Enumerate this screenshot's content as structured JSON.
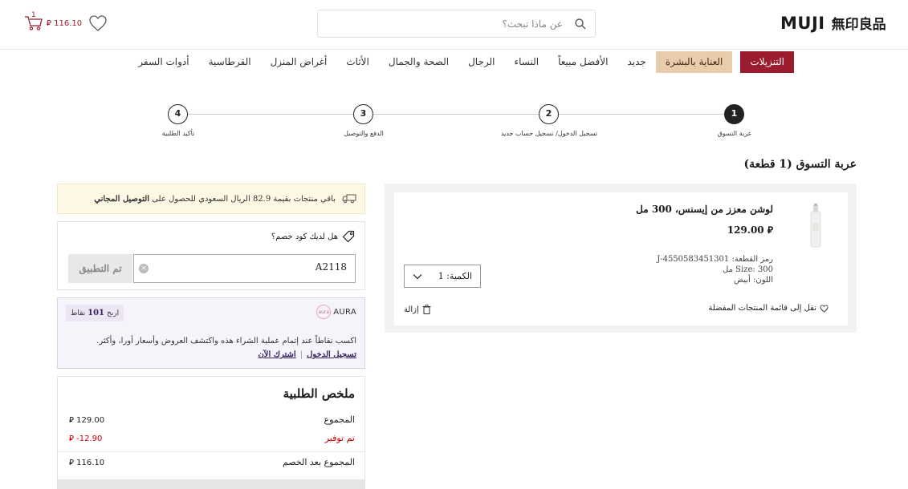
{
  "header": {
    "logo_latin": "MUJI",
    "logo_kanji": "無印良品",
    "search_placeholder": "عن ماذا تبحث؟",
    "cart_count": "1",
    "cart_total": "116.10"
  },
  "nav": {
    "items": [
      "التنزيلات",
      "العناية بالبشرة",
      "جديد",
      "الأفضل مبيعاً",
      "النساء",
      "الرجال",
      "الصحة والجمال",
      "الأثاث",
      "أغراض المنزل",
      "القرطاسية",
      "أدوات السفر"
    ]
  },
  "steps": [
    {
      "num": "1",
      "label": "عربة التسوق"
    },
    {
      "num": "2",
      "label": "تسجيل الدخول/ تسجيل حساب جديد"
    },
    {
      "num": "3",
      "label": "الدفع والتوصيل"
    },
    {
      "num": "4",
      "label": "تأكيد الطلبية"
    }
  ],
  "cart": {
    "title": "عربة التسوق (1 قطعة)",
    "item": {
      "name": "لوشن معزز من إيسنس، 300 مل",
      "price": "129.00",
      "sku": "رمز القطعة: J-4550583451301",
      "size": "Size: 300 مل",
      "color": "اللون: أبيض",
      "qty_label": "الكمية: 1",
      "remove": "إزالة",
      "wishlist": "نقل إلى قائمة المنتجات المفضلة"
    }
  },
  "shipping": {
    "text_prefix": "باقي منتجات بقيمة 82.9 الريال السعودي للحصول على ",
    "text_bold": "التوصيل المجاني"
  },
  "coupon": {
    "question": "هل لديك كود خصم؟",
    "value": "A2118",
    "apply": "تم التطبيق",
    "clear": "×"
  },
  "aura": {
    "brand": "AURA",
    "mark": "aura",
    "badge_prefix": "اربح",
    "badge_points": "101",
    "badge_suffix": "نقاط",
    "desc": "اكسب نقاطاً عند إتمام عملية الشراء هذه واكتشف العروض وأسعار أورا، وأكثر.",
    "login": "تسجيل الدخول",
    "signup": "اشترك الآن"
  },
  "summary": {
    "title": "ملخص الطلبية",
    "subtotal_label": "المجموع",
    "subtotal_value": "129.00",
    "saved_label": "تم توفير",
    "saved_value": "-12.90",
    "after_label": "المجموع بعد الخصم",
    "after_value": "116.10"
  },
  "colors": {
    "brand_red": "#9b1c2e",
    "skincare_tan": "#e9ccab",
    "aura_purple": "#3a2460"
  }
}
